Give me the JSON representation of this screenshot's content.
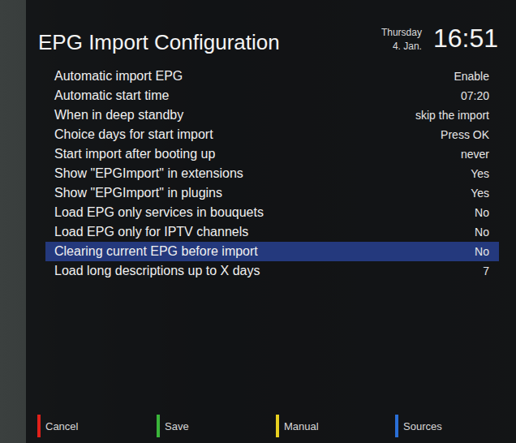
{
  "screen": {
    "title": "EPG Import Configuration"
  },
  "clock": {
    "day": "Thursday",
    "date": "4. Jan.",
    "time": "16:51"
  },
  "settings": [
    {
      "label": "Automatic import EPG",
      "value": "Enable",
      "selected": false
    },
    {
      "label": "Automatic start time",
      "value": "07:20",
      "selected": false
    },
    {
      "label": "When in deep standby",
      "value": "skip the import",
      "selected": false
    },
    {
      "label": "Choice days for start import",
      "value": "Press OK",
      "selected": false
    },
    {
      "label": "Start import after booting up",
      "value": "never",
      "selected": false
    },
    {
      "label": "Show \"EPGImport\" in extensions",
      "value": "Yes",
      "selected": false
    },
    {
      "label": "Show \"EPGImport\" in plugins",
      "value": "Yes",
      "selected": false
    },
    {
      "label": "Load EPG only services in bouquets",
      "value": "No",
      "selected": false
    },
    {
      "label": "Load EPG only for IPTV channels",
      "value": "No",
      "selected": false
    },
    {
      "label": "Clearing current EPG before import",
      "value": "No",
      "selected": true
    },
    {
      "label": "Load long descriptions up to X days",
      "value": "7",
      "selected": false
    }
  ],
  "buttons": [
    {
      "label": "Cancel",
      "color": "#e0201a"
    },
    {
      "label": "Save",
      "color": "#3ab53a"
    },
    {
      "label": "Manual",
      "color": "#e8d020"
    },
    {
      "label": "Sources",
      "color": "#2a6fd6"
    }
  ]
}
